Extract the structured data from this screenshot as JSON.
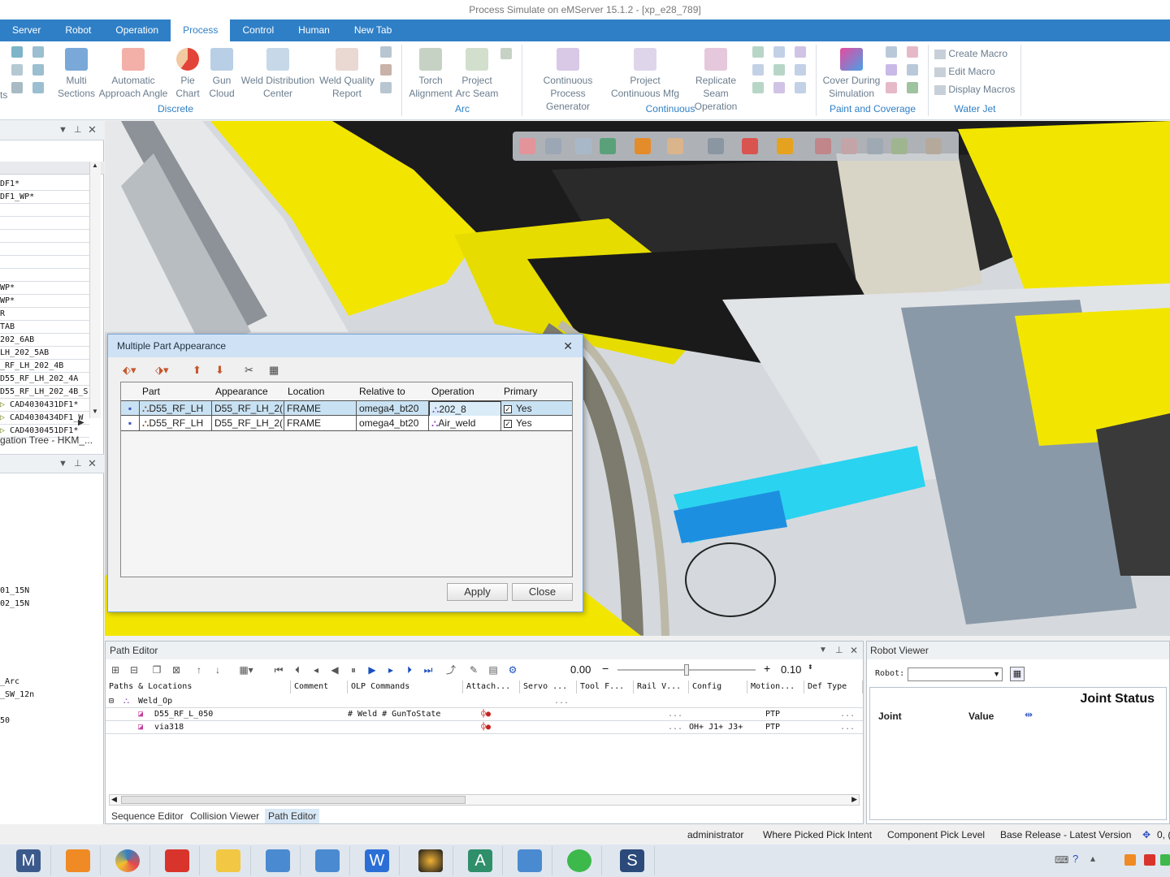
{
  "window": {
    "title": "Process Simulate on eMServer 15.1.2 - [xp_e28_789]"
  },
  "menu": {
    "tabs": [
      "Server",
      "Robot",
      "Operation",
      "Process",
      "Control",
      "Human",
      "New Tab"
    ],
    "active": "Process"
  },
  "ribbon": {
    "edge_text": "ts",
    "multi_sections": [
      "Multi",
      "Sections"
    ],
    "automatic_approach": [
      "Automatic",
      "Approach Angle"
    ],
    "pie_chart": [
      "Pie",
      "Chart"
    ],
    "gun_cloud": [
      "Gun",
      "Cloud"
    ],
    "weld_distribution": [
      "Weld Distribution",
      "Center"
    ],
    "weld_quality": [
      "Weld Quality",
      "Report"
    ],
    "group_discrete": "Discrete",
    "torch_alignment": [
      "Torch",
      "Alignment"
    ],
    "project_arc_seam": [
      "Project",
      "Arc Seam"
    ],
    "group_arc": "Arc",
    "continuous_process": [
      "Continuous",
      "Process Generator"
    ],
    "project_continuous": [
      "Project",
      "Continuous Mfg"
    ],
    "replicate_seam": [
      "Replicate Seam",
      "Operation"
    ],
    "group_continuous": "Continuous",
    "cover_during": [
      "Cover During",
      "Simulation"
    ],
    "group_paint": "Paint and Coverage",
    "create_macro": "Create Macro",
    "edit_macro": "Edit Macro",
    "display_macros": "Display Macros",
    "group_waterjet": "Water Jet"
  },
  "left_tree": {
    "rows": [
      "DF1*",
      "DF1_WP*",
      "",
      "",
      "",
      "",
      "",
      "",
      "WP*",
      "WP*",
      "R",
      "TAB",
      "202_6AB",
      "LH_202_5AB",
      "_RF_LH_202_4B",
      "D55_RF_LH_202_4A",
      "D55_RF_LH_202_4B_S",
      "CAD4030431DF1*",
      "CAD4030434DF1_W",
      "CAD4030451DF1*"
    ],
    "footer": "gation Tree - HKM_...",
    "lower_items": [
      "01_15N",
      "02_15N",
      "_Arc",
      "_SW_12n",
      "50"
    ]
  },
  "dialog": {
    "title": "Multiple Part Appearance",
    "columns": [
      "Part",
      "Appearance",
      "Location",
      "Relative to",
      "Operation",
      "Primary"
    ],
    "rows": [
      {
        "part": "D55_RF_LH",
        "appearance": "D55_RF_LH_2(",
        "location": "FRAME",
        "relative": "omega4_bt20",
        "operation": "202_8",
        "primary": "Yes"
      },
      {
        "part": "D55_RF_LH",
        "appearance": "D55_RF_LH_2(",
        "location": "FRAME",
        "relative": "omega4_bt20",
        "operation": "Air_weld",
        "primary": "Yes"
      }
    ],
    "apply": "Apply",
    "close": "Close"
  },
  "path_editor": {
    "title": "Path Editor",
    "speed_value": "0.00",
    "step_value": "0.10",
    "columns": [
      "Paths & Locations",
      "Comment",
      "OLP Commands",
      "Attach...",
      "Servo ...",
      "Tool F...",
      "Rail V...",
      "Config",
      "Motion...",
      "Def Type"
    ],
    "rows": [
      {
        "name": "Weld_Op",
        "olp": "",
        "config": "",
        "motion": ""
      },
      {
        "name": "D55_RF_L_050",
        "olp": "# Weld  # GunToState",
        "config": "",
        "motion": "PTP"
      },
      {
        "name": "via318",
        "olp": "",
        "config": "OH+ J1+ J3+",
        "motion": "PTP"
      }
    ],
    "bottom_tabs": [
      "Sequence Editor",
      "Collision Viewer",
      "Path Editor"
    ],
    "active_tab": "Path Editor"
  },
  "robot_viewer": {
    "title": "Robot Viewer",
    "robot_label": "Robot:",
    "joint_status": "Joint Status",
    "joint": "Joint",
    "value": "Value"
  },
  "status_bar": {
    "user": "administrator",
    "pick_intent": "Where Picked Pick Intent",
    "pick_level": "Component Pick Level",
    "release": "Base Release - Latest Version",
    "coords": "0, ("
  },
  "taskbar": {
    "items": [
      "M",
      "office-icon",
      "browser-icon",
      "pdf-icon",
      "files-icon",
      "ps-icon",
      "ps2-icon",
      "W",
      "capture-icon",
      "A",
      "ps3-icon",
      "wechat-icon",
      "S"
    ]
  },
  "colors": {
    "accent": "#2f7fc6",
    "dialog_title": "#cfe2f5",
    "robot_yellow": "#f2e600",
    "part_cyan": "#2ad3f0"
  }
}
